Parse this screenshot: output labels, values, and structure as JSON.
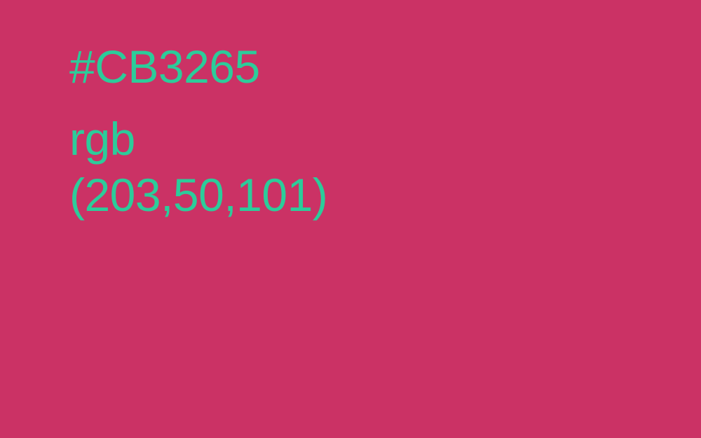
{
  "colors": {
    "background": "#CB3265",
    "text": "#2CCC9A"
  },
  "swatch": {
    "hex_label": "#CB3265",
    "rgb_prefix": "rgb",
    "rgb_values": "(203,50,101)"
  }
}
